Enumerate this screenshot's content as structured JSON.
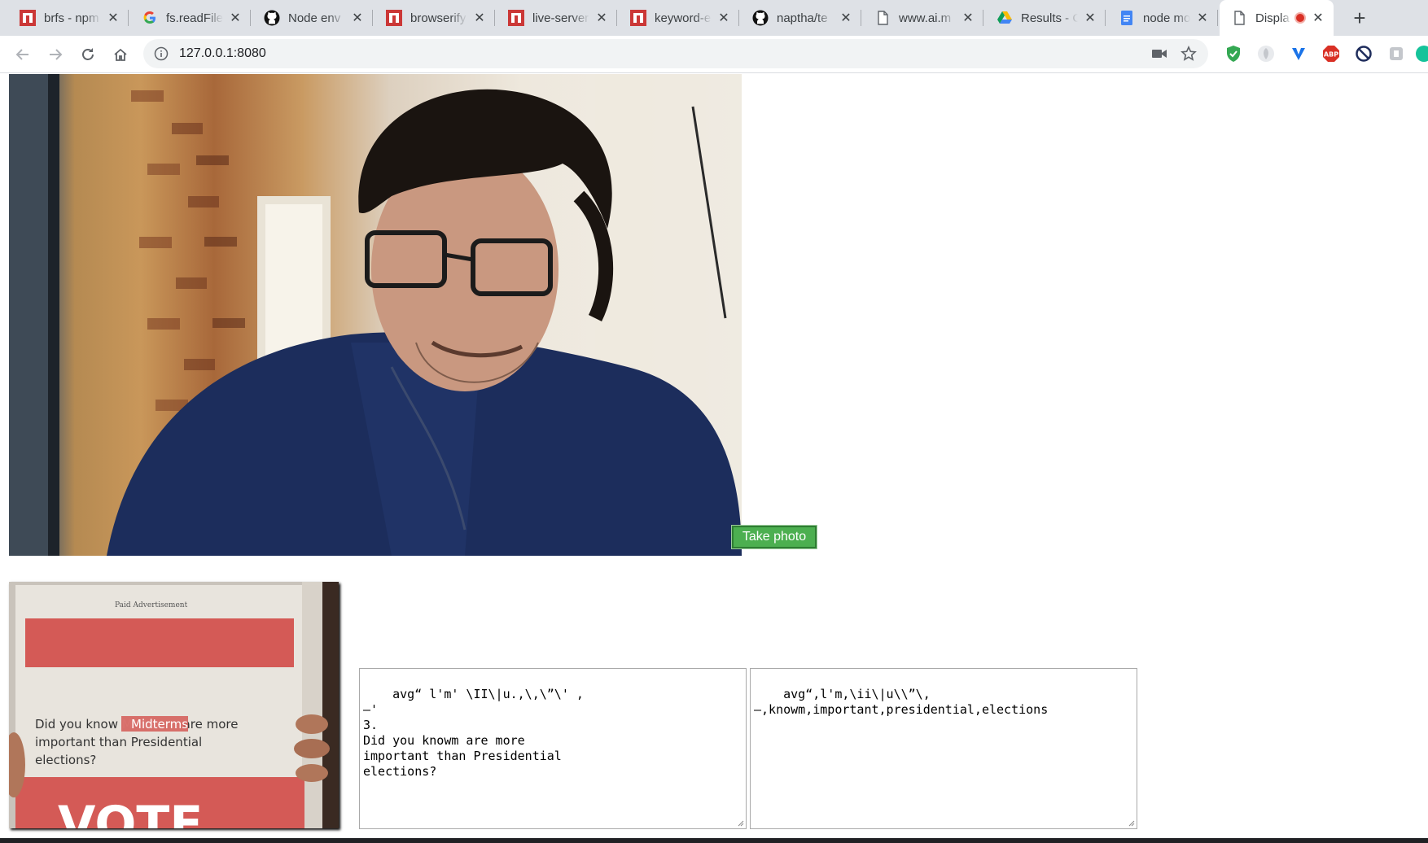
{
  "browser": {
    "tabs": [
      {
        "title": "brfs - npm",
        "icon": "npm-icon",
        "active": false
      },
      {
        "title": "fs.readFile",
        "icon": "google-icon",
        "active": false
      },
      {
        "title": "Node env",
        "icon": "github-icon",
        "active": false
      },
      {
        "title": "browserify",
        "icon": "npm-icon",
        "active": false
      },
      {
        "title": "live-server",
        "icon": "npm-icon",
        "active": false
      },
      {
        "title": "keyword-e",
        "icon": "npm-icon",
        "active": false
      },
      {
        "title": "naptha/te",
        "icon": "github-icon",
        "active": false
      },
      {
        "title": "www.ai.m",
        "icon": "page-icon",
        "active": false
      },
      {
        "title": "Results - C",
        "icon": "google-drive-icon",
        "active": false
      },
      {
        "title": "node mod",
        "icon": "google-docs-icon",
        "active": false
      },
      {
        "title": "Displa",
        "icon": "page-icon",
        "active": true,
        "recording": true
      }
    ],
    "new_tab_label": "+",
    "close_glyph": "✕",
    "address": "127.0.0.1:8080",
    "extensions": [
      "shield-check-icon",
      "leaf-icon",
      "v-icon",
      "adblock-icon",
      "block-icon",
      "puzzle-icon",
      "green-g-icon"
    ]
  },
  "page": {
    "take_photo_label": "Take photo",
    "photo_content": {
      "header": "Paid Advertisement",
      "headline_pre": "Did you know ",
      "headline_highlight": "Midterms",
      "headline_post": " are more",
      "line2": "important than Presidential",
      "line3": "elections?",
      "bottom_word": "VOTE"
    },
    "ocr_text": "avg“ l'm' \\II\\|u.,\\,\\”\\' ,\n—'\n3.\nDid you knowm are more\nimportant than Presidential\nelections?",
    "keywords_text": "avg“,l'm,\\ii\\|u\\\\”\\,\n—,knowm,important,presidential,elections"
  },
  "colors": {
    "tabstrip_bg": "#dee1e6",
    "button_green": "#4caf50",
    "npm_red": "#cb3837",
    "record_red": "#d93025"
  }
}
